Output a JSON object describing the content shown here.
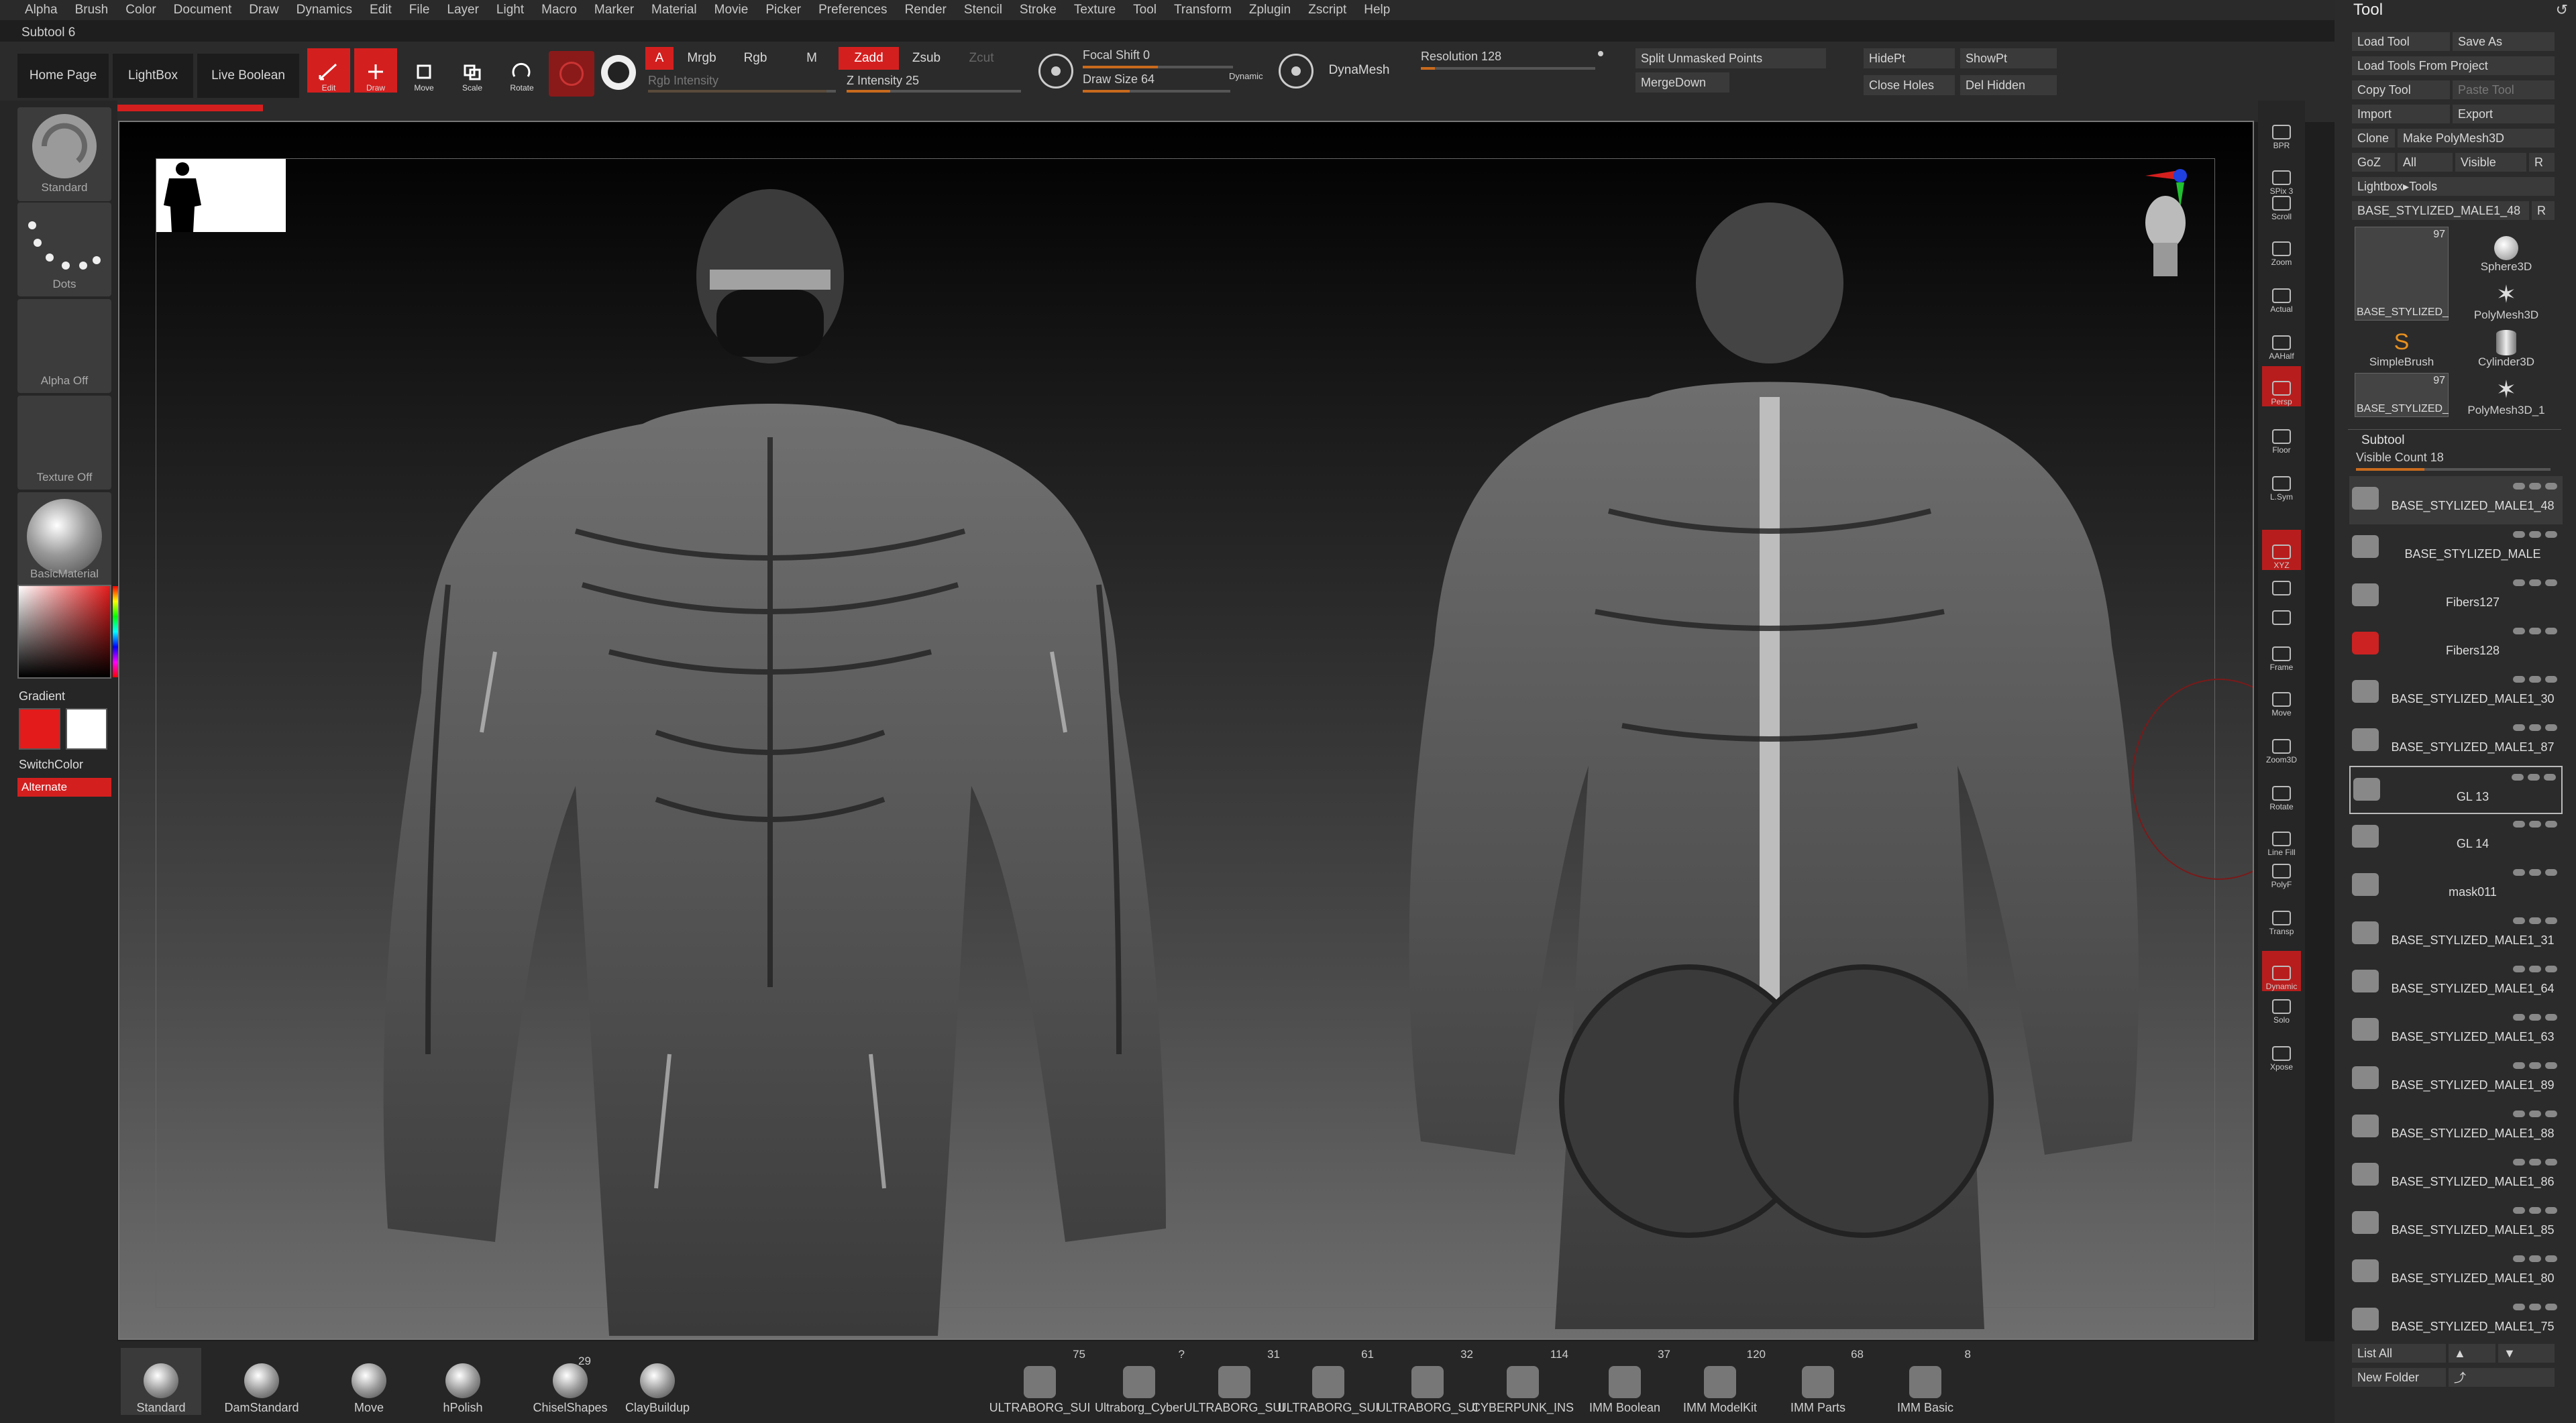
{
  "menu": [
    "Alpha",
    "Brush",
    "Color",
    "Document",
    "Draw",
    "Dynamics",
    "Edit",
    "File",
    "Layer",
    "Light",
    "Macro",
    "Marker",
    "Material",
    "Movie",
    "Picker",
    "Preferences",
    "Render",
    "Stencil",
    "Stroke",
    "Texture",
    "Tool",
    "Transform",
    "Zplugin",
    "Zscript",
    "Help"
  ],
  "subtool_label": "Subtool 6",
  "top": {
    "home": "Home Page",
    "lightbox": "LightBox",
    "liveboolean": "Live Boolean",
    "edit": "Edit",
    "draw": "Draw",
    "move": "Move",
    "scale": "Scale",
    "rotate": "Rotate",
    "a": "A",
    "mrgb": "Mrgb",
    "rgb": "Rgb",
    "m": "M",
    "rgb_intensity": "Rgb Intensity",
    "zadd": "Zadd",
    "zsub": "Zsub",
    "zcut": "Zcut",
    "z_intensity": "Z Intensity 25",
    "focal": "Focal Shift 0",
    "drawsize": "Draw Size 64",
    "dynamic": "Dynamic",
    "dynamesh": "DynaMesh",
    "resolution": "Resolution 128",
    "split": "Split Unmasked Points",
    "mergedown": "MergeDown",
    "hidept": "HidePt",
    "showpt": "ShowPt",
    "closeholes": "Close Holes",
    "delhidden": "Del Hidden"
  },
  "left": {
    "standard": "Standard",
    "dots": "Dots",
    "alpha": "Alpha Off",
    "texture": "Texture Off",
    "material": "BasicMaterial",
    "gradient": "Gradient",
    "switchcolor": "SwitchColor",
    "alternate": "Alternate"
  },
  "right_shelf": [
    "BPR",
    "SPix 3",
    "Scroll",
    "Zoom",
    "Actual",
    "AAHalf",
    "Persp",
    "Floor",
    "L.Sym",
    "",
    "XYZ",
    "",
    "",
    "Frame",
    "Move",
    "Zoom3D",
    "Rotate",
    "Line Fill",
    "PolyF",
    "Transp",
    "Dynamic",
    "Solo",
    "Xpose"
  ],
  "colors": {
    "primary": "#e41b1b",
    "secondary": "#ffffff",
    "accent": "#d41f1f"
  },
  "tool": {
    "title": "Tool",
    "load": "Load Tool",
    "saveas": "Save As",
    "loadproj": "Load Tools From Project",
    "copy": "Copy Tool",
    "paste": "Paste Tool",
    "import": "Import",
    "export": "Export",
    "clone": "Clone",
    "makepoly": "Make PolyMesh3D",
    "goz": "GoZ",
    "all": "All",
    "visible": "Visible",
    "r": "R",
    "lightboxtools": "Lightbox▸Tools",
    "current": "BASE_STYLIZED_MALE1_48",
    "r2": "R",
    "thumbs": [
      {
        "name": "BASE_STYLIZED_",
        "count": "97"
      },
      {
        "name": "Sphere3D",
        "count": ""
      },
      {
        "name": "SimpleBrush",
        "count": ""
      },
      {
        "name": "PolyMesh3D",
        "count": ""
      },
      {
        "name": "Cylinder3D",
        "count": ""
      },
      {
        "name": "BASE_STYLIZED_",
        "count": "97"
      },
      {
        "name": "PolyMesh3D_1",
        "count": ""
      }
    ],
    "subtool_title": "Subtool",
    "visible_count": "Visible Count 18",
    "subtools": [
      "BASE_STYLIZED_MALE1_48",
      "BASE_STYLIZED_MALE",
      "Fibers127",
      "Fibers128",
      "BASE_STYLIZED_MALE1_30",
      "BASE_STYLIZED_MALE1_87",
      "GL 13",
      "GL 14",
      "mask011",
      "BASE_STYLIZED_MALE1_31",
      "BASE_STYLIZED_MALE1_64",
      "BASE_STYLIZED_MALE1_63",
      "BASE_STYLIZED_MALE1_89",
      "BASE_STYLIZED_MALE1_88",
      "BASE_STYLIZED_MALE1_86",
      "BASE_STYLIZED_MALE1_85",
      "BASE_STYLIZED_MALE1_80",
      "BASE_STYLIZED_MALE1_75"
    ],
    "listall": "List All",
    "newfolder": "New Folder"
  },
  "bottom_brushes": [
    "Standard",
    "DamStandard",
    "Move",
    "hPolish",
    "ChiselShapes",
    "ClayBuildup"
  ],
  "bottom_brush_count": "29",
  "bottom_insert": [
    {
      "name": "ULTRABORG_SUI",
      "count": "75"
    },
    {
      "name": "Ultraborg_Cyber",
      "count": "?"
    },
    {
      "name": "ULTRABORG_SUI",
      "count": "31"
    },
    {
      "name": "ULTRABORG_SUI",
      "count": "61"
    },
    {
      "name": "ULTRABORG_SUI",
      "count": "32"
    },
    {
      "name": "CYBERPUNK_INS",
      "count": "114"
    },
    {
      "name": "IMM Boolean",
      "count": "37"
    },
    {
      "name": "IMM ModelKit",
      "count": "120"
    },
    {
      "name": "IMM Parts",
      "count": "68"
    },
    {
      "name": "IMM Basic",
      "count": "8"
    }
  ]
}
